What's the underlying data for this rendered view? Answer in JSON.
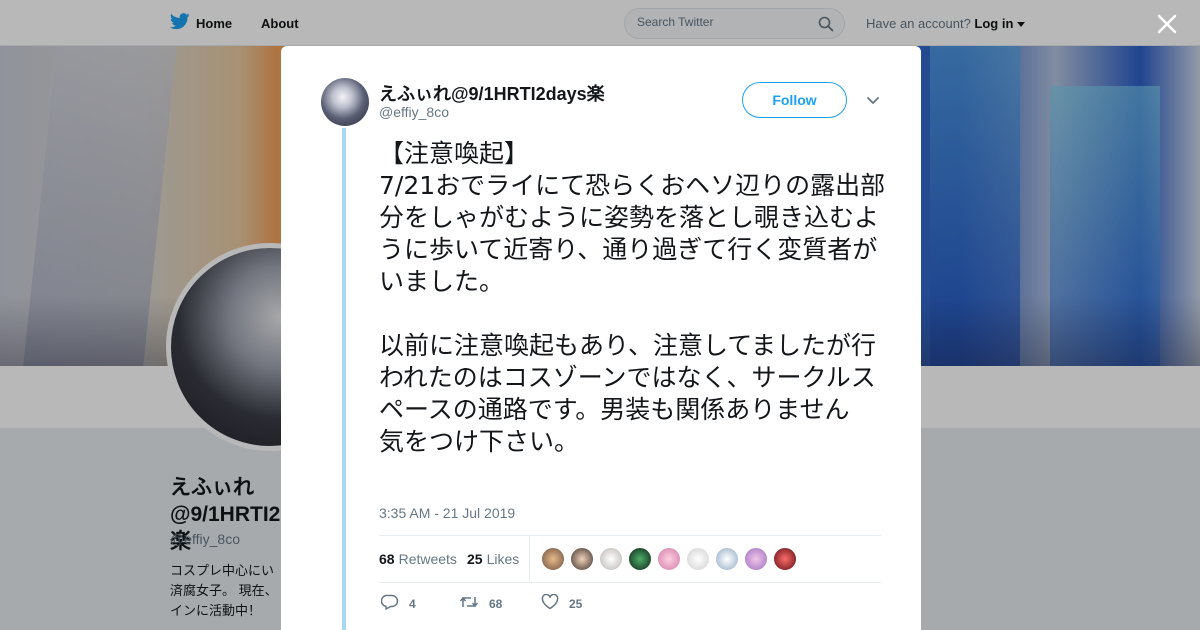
{
  "topbar": {
    "home_label": "Home",
    "about_label": "About",
    "search_placeholder": "Search Twitter",
    "have_account": "Have an account?",
    "login_label": "Log in"
  },
  "profile": {
    "name": "えふぃれ@9/1HRTI2days楽",
    "handle": "@effiy_8co",
    "bio": "コスプレ中心にい済腐女子。 現在、インに活動中！"
  },
  "tweet": {
    "author_name": "えふぃれ@9/1HRTI2days楽",
    "author_handle": "@effiy_8co",
    "follow_label": "Follow",
    "text": "【注意喚起】\n7/21おでライにて恐らくおヘソ辺りの露出部分をしゃがむように姿勢を落とし覗き込むように歩いて近寄り、通り過ぎて行く変質者がいました。\n\n以前に注意喚起もあり、注意してましたが行われたのはコスゾーンではなく、サークルスペースの通路です。男装も関係ありません\n気をつけ下さい。",
    "timestamp": "3:35 AM - 21 Jul 2019",
    "retweets_count": "68",
    "retweets_label": "Retweets",
    "likes_count": "25",
    "likes_label": "Likes",
    "reply_count": "4",
    "retweet_action_count": "68",
    "like_action_count": "25"
  },
  "colors": {
    "accent": "#1da1f2",
    "thread_line": "#a7d9f4",
    "muted": "#657786"
  },
  "likers": [
    "avatar-1",
    "avatar-2",
    "avatar-3",
    "avatar-4",
    "avatar-5",
    "avatar-6",
    "avatar-7",
    "avatar-8",
    "avatar-9"
  ]
}
